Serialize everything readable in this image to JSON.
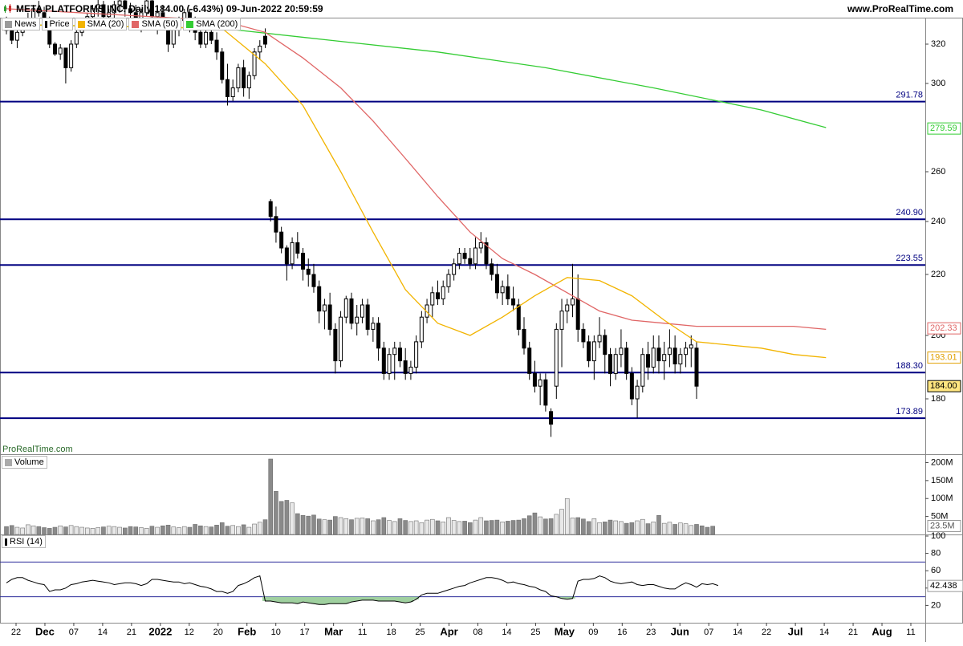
{
  "header": {
    "title": "META PLATFORMS INC. Daily 184.00 (-6.43%) 09-Jun-2022 20:59:59",
    "site": "www.ProRealTime.com"
  },
  "legend": [
    {
      "label": "News",
      "color": "#808080",
      "icon": "news-icon"
    },
    {
      "label": "Price",
      "color": "#000000",
      "icon": "candle-icon"
    },
    {
      "label": "SMA (20)",
      "color": "#f2b400"
    },
    {
      "label": "SMA (50)",
      "color": "#e06666"
    },
    {
      "label": "SMA (200)",
      "color": "#33cc33"
    }
  ],
  "watermark": "ProRealTime.com",
  "volume_label": "Volume",
  "rsi_label": "RSI (14)",
  "colors": {
    "sma20": "#f2b400",
    "sma50": "#e06666",
    "sma200": "#33cc33",
    "level_line": "#000080",
    "rsi_fill": "#9fd09f",
    "candle": "#000000"
  },
  "chart_data": [
    {
      "type": "candlestick",
      "title": "META PLATFORMS INC. Daily 184.00 (-6.43%) 09-Jun-2022 20:59:59",
      "series_name": "Price",
      "ylim": [
        164,
        326
      ],
      "y_ticks": [
        180,
        200,
        220,
        240,
        260,
        300,
        320
      ],
      "x_tick_labels": [
        "22",
        "Dec",
        "07",
        "14",
        "21",
        "2022",
        "12",
        "20",
        "Feb",
        "10",
        "17",
        "Mar",
        "11",
        "18",
        "25",
        "Apr",
        "08",
        "14",
        "25",
        "May",
        "09",
        "16",
        "23",
        "Jun",
        "07",
        "14",
        "22",
        "Jul",
        "14",
        "21",
        "Aug",
        "11"
      ],
      "horizontal_levels": [
        "291.78",
        "240.90",
        "223.55",
        "188.30",
        "173.89"
      ],
      "last_value_labels": {
        "sma200": "279.59",
        "sma50": "202.33",
        "sma20": "193.01",
        "price": "184.00"
      },
      "candles": [
        [
          331,
          334,
          325,
          327
        ],
        [
          327,
          330,
          320,
          322
        ],
        [
          322,
          328,
          318,
          326
        ],
        [
          326,
          332,
          324,
          330
        ],
        [
          330,
          336,
          328,
          333
        ],
        [
          333,
          340,
          330,
          338
        ],
        [
          338,
          342,
          334,
          336
        ],
        [
          336,
          339,
          330,
          332
        ],
        [
          332,
          334,
          318,
          320
        ],
        [
          320,
          321,
          314,
          315
        ],
        [
          315,
          320,
          312,
          318
        ],
        [
          318,
          318,
          300,
          308
        ],
        [
          308,
          322,
          306,
          320
        ],
        [
          320,
          328,
          318,
          326
        ],
        [
          326,
          333,
          324,
          330
        ],
        [
          330,
          336,
          328,
          334
        ],
        [
          334,
          340,
          332,
          338
        ],
        [
          338,
          344,
          334,
          340
        ],
        [
          340,
          342,
          332,
          334
        ],
        [
          334,
          338,
          330,
          336
        ],
        [
          336,
          342,
          333,
          340
        ],
        [
          340,
          346,
          336,
          342
        ],
        [
          342,
          345,
          334,
          338
        ],
        [
          338,
          341,
          330,
          336
        ],
        [
          336,
          340,
          328,
          332
        ],
        [
          332,
          338,
          326,
          336
        ],
        [
          336,
          345,
          334,
          342
        ],
        [
          342,
          344,
          330,
          334
        ],
        [
          334,
          338,
          325,
          336
        ],
        [
          336,
          340,
          328,
          330
        ],
        [
          330,
          332,
          316,
          320
        ],
        [
          320,
          330,
          318,
          328
        ],
        [
          328,
          334,
          324,
          332
        ],
        [
          332,
          338,
          330,
          336
        ],
        [
          336,
          338,
          326,
          328
        ],
        [
          328,
          334,
          322,
          326
        ],
        [
          326,
          330,
          318,
          320
        ],
        [
          320,
          328,
          318,
          326
        ],
        [
          326,
          330,
          320,
          322
        ],
        [
          322,
          326,
          312,
          316
        ],
        [
          316,
          318,
          300,
          302
        ],
        [
          302,
          310,
          290,
          294
        ],
        [
          294,
          302,
          292,
          298
        ],
        [
          298,
          310,
          296,
          308
        ],
        [
          308,
          312,
          294,
          298
        ],
        [
          298,
          306,
          293,
          304
        ],
        [
          304,
          318,
          302,
          316
        ],
        [
          316,
          322,
          312,
          319
        ],
        [
          324,
          328,
          318,
          320
        ],
        [
          248,
          249,
          240,
          242
        ],
        [
          242,
          246,
          232,
          236
        ],
        [
          236,
          238,
          228,
          230
        ],
        [
          230,
          231,
          218,
          224
        ],
        [
          224,
          234,
          222,
          232
        ],
        [
          232,
          236,
          226,
          228
        ],
        [
          228,
          230,
          218,
          222
        ],
        [
          222,
          226,
          216,
          220
        ],
        [
          220,
          224,
          214,
          216
        ],
        [
          216,
          218,
          204,
          208
        ],
        [
          208,
          212,
          202,
          210
        ],
        [
          210,
          214,
          200,
          202
        ],
        [
          202,
          204,
          188,
          192
        ],
        [
          192,
          208,
          190,
          206
        ],
        [
          206,
          213,
          204,
          212
        ],
        [
          212,
          214,
          202,
          204
        ],
        [
          204,
          210,
          200,
          206
        ],
        [
          206,
          212,
          204,
          210
        ],
        [
          210,
          212,
          200,
          202
        ],
        [
          202,
          206,
          198,
          204
        ],
        [
          204,
          206,
          192,
          196
        ],
        [
          196,
          198,
          186,
          188
        ],
        [
          188,
          196,
          186,
          194
        ],
        [
          194,
          198,
          186,
          196
        ],
        [
          196,
          198,
          190,
          192
        ],
        [
          192,
          196,
          186,
          188
        ],
        [
          188,
          192,
          186,
          190
        ],
        [
          190,
          200,
          188,
          198
        ],
        [
          198,
          208,
          196,
          206
        ],
        [
          206,
          212,
          204,
          210
        ],
        [
          210,
          216,
          206,
          214
        ],
        [
          214,
          218,
          210,
          212
        ],
        [
          212,
          218,
          210,
          216
        ],
        [
          216,
          222,
          214,
          220
        ],
        [
          220,
          226,
          218,
          224
        ],
        [
          224,
          230,
          222,
          228
        ],
        [
          228,
          230,
          224,
          226
        ],
        [
          226,
          230,
          222,
          224
        ],
        [
          224,
          234,
          222,
          230
        ],
        [
          230,
          236,
          228,
          232
        ],
        [
          232,
          234,
          222,
          224
        ],
        [
          224,
          226,
          218,
          220
        ],
        [
          220,
          224,
          212,
          214
        ],
        [
          214,
          218,
          210,
          216
        ],
        [
          216,
          220,
          210,
          212
        ],
        [
          212,
          216,
          208,
          210
        ],
        [
          210,
          212,
          200,
          202
        ],
        [
          202,
          206,
          194,
          196
        ],
        [
          196,
          198,
          186,
          188
        ],
        [
          188,
          192,
          182,
          184
        ],
        [
          184,
          188,
          178,
          186
        ],
        [
          186,
          188,
          176,
          178
        ],
        [
          176,
          177,
          168,
          172
        ],
        [
          184,
          204,
          180,
          202
        ],
        [
          202,
          212,
          190,
          208
        ],
        [
          208,
          212,
          204,
          210
        ],
        [
          210,
          224,
          206,
          212
        ],
        [
          212,
          220,
          198,
          202
        ],
        [
          202,
          204,
          196,
          198
        ],
        [
          198,
          200,
          190,
          192
        ],
        [
          192,
          200,
          186,
          198
        ],
        [
          198,
          206,
          196,
          200
        ],
        [
          200,
          202,
          188,
          194
        ],
        [
          194,
          196,
          184,
          188
        ],
        [
          188,
          196,
          186,
          194
        ],
        [
          194,
          202,
          190,
          196
        ],
        [
          196,
          198,
          186,
          188
        ],
        [
          188,
          190,
          178,
          180
        ],
        [
          180,
          186,
          174,
          184
        ],
        [
          184,
          196,
          182,
          194
        ],
        [
          194,
          198,
          186,
          190
        ],
        [
          190,
          200,
          188,
          196
        ],
        [
          196,
          200,
          188,
          192
        ],
        [
          192,
          198,
          186,
          194
        ],
        [
          194,
          202,
          190,
          196
        ],
        [
          196,
          200,
          188,
          191
        ],
        [
          191,
          196,
          188,
          194
        ],
        [
          194,
          198,
          190,
          196
        ],
        [
          196,
          200,
          190,
          197
        ],
        [
          196,
          198,
          180,
          184
        ]
      ],
      "sma20_points": [
        [
          0,
          330
        ],
        [
          40,
          328
        ],
        [
          48,
          310
        ],
        [
          55,
          290
        ],
        [
          62,
          260
        ],
        [
          68,
          236
        ],
        [
          74,
          215
        ],
        [
          80,
          204
        ],
        [
          86,
          200
        ],
        [
          92,
          206
        ],
        [
          98,
          213
        ],
        [
          104,
          219
        ],
        [
          110,
          218
        ],
        [
          116,
          213
        ],
        [
          122,
          205
        ],
        [
          128,
          198
        ],
        [
          134,
          197
        ],
        [
          140,
          196
        ],
        [
          146,
          194
        ],
        [
          152,
          193
        ]
      ],
      "sma50_points": [
        [
          0,
          338
        ],
        [
          40,
          332
        ],
        [
          48,
          326
        ],
        [
          55,
          313
        ],
        [
          62,
          298
        ],
        [
          68,
          283
        ],
        [
          74,
          266
        ],
        [
          80,
          250
        ],
        [
          86,
          236
        ],
        [
          92,
          226
        ],
        [
          98,
          220
        ],
        [
          104,
          214
        ],
        [
          110,
          208
        ],
        [
          116,
          205
        ],
        [
          122,
          204
        ],
        [
          128,
          203
        ],
        [
          134,
          203
        ],
        [
          140,
          203
        ],
        [
          146,
          203
        ],
        [
          152,
          202
        ]
      ],
      "sma200_points": [
        [
          0,
          330
        ],
        [
          40,
          328
        ],
        [
          60,
          322
        ],
        [
          80,
          316
        ],
        [
          100,
          308
        ],
        [
          120,
          298
        ],
        [
          140,
          288
        ],
        [
          152,
          280
        ]
      ]
    },
    {
      "type": "bar",
      "series_name": "Volume",
      "y_ticks": [
        "50M",
        "100M",
        "150M",
        "200M"
      ],
      "last_value_label": "23.5M",
      "ylim": [
        0,
        210
      ],
      "values": [
        22,
        25,
        20,
        18,
        27,
        24,
        22,
        19,
        17,
        20,
        24,
        21,
        25,
        22,
        20,
        18,
        17,
        19,
        21,
        23,
        22,
        20,
        18,
        22,
        21,
        19,
        17,
        23,
        20,
        24,
        26,
        21,
        19,
        22,
        20,
        28,
        24,
        22,
        21,
        26,
        33,
        23,
        25,
        22,
        27,
        20,
        29,
        34,
        41,
        210,
        120,
        92,
        95,
        88,
        58,
        53,
        51,
        54,
        43,
        41,
        40,
        50,
        47,
        44,
        41,
        45,
        46,
        44,
        38,
        41,
        47,
        39,
        36,
        44,
        39,
        36,
        38,
        33,
        40,
        42,
        38,
        35,
        47,
        39,
        36,
        37,
        33,
        40,
        47,
        38,
        39,
        40,
        35,
        37,
        39,
        40,
        44,
        52,
        60,
        49,
        43,
        44,
        56,
        70,
        100,
        46,
        47,
        43,
        36,
        44,
        33,
        35,
        40,
        38,
        36,
        31,
        33,
        38,
        42,
        30,
        35,
        53,
        31,
        34,
        28,
        32,
        30,
        25,
        28,
        24,
        20,
        23
      ]
    },
    {
      "type": "line",
      "series_name": "RSI (14)",
      "ylim": [
        0,
        100
      ],
      "y_ticks": [
        20,
        40,
        60,
        80,
        100
      ],
      "levels": [
        70,
        30
      ],
      "last_value_label": "42.438",
      "values": [
        46,
        50,
        52,
        52,
        49,
        47,
        45,
        44,
        36,
        38,
        38,
        40,
        44,
        45,
        47,
        48,
        49,
        48,
        47,
        46,
        44,
        45,
        46,
        46,
        45,
        43,
        45,
        50,
        50,
        49,
        48,
        47,
        47,
        45,
        46,
        44,
        42,
        41,
        39,
        36,
        36,
        34,
        36,
        43,
        45,
        48,
        52,
        54,
        25,
        25,
        24,
        23,
        23,
        23,
        22,
        24,
        23,
        22,
        21,
        21,
        22,
        22,
        22,
        22,
        24,
        25,
        26,
        26,
        26,
        25,
        25,
        25,
        25,
        24,
        23,
        24,
        27,
        32,
        34,
        34,
        34,
        36,
        38,
        40,
        42,
        43,
        46,
        48,
        50,
        52,
        52,
        51,
        49,
        46,
        47,
        45,
        44,
        42,
        41,
        38,
        36,
        31,
        30,
        28,
        27,
        28,
        48,
        50,
        50,
        51,
        54,
        52,
        48,
        46,
        45,
        46,
        47,
        44,
        43,
        44,
        44,
        42,
        40,
        39,
        39,
        43,
        46,
        44,
        41,
        45,
        44,
        45,
        43
      ]
    }
  ]
}
